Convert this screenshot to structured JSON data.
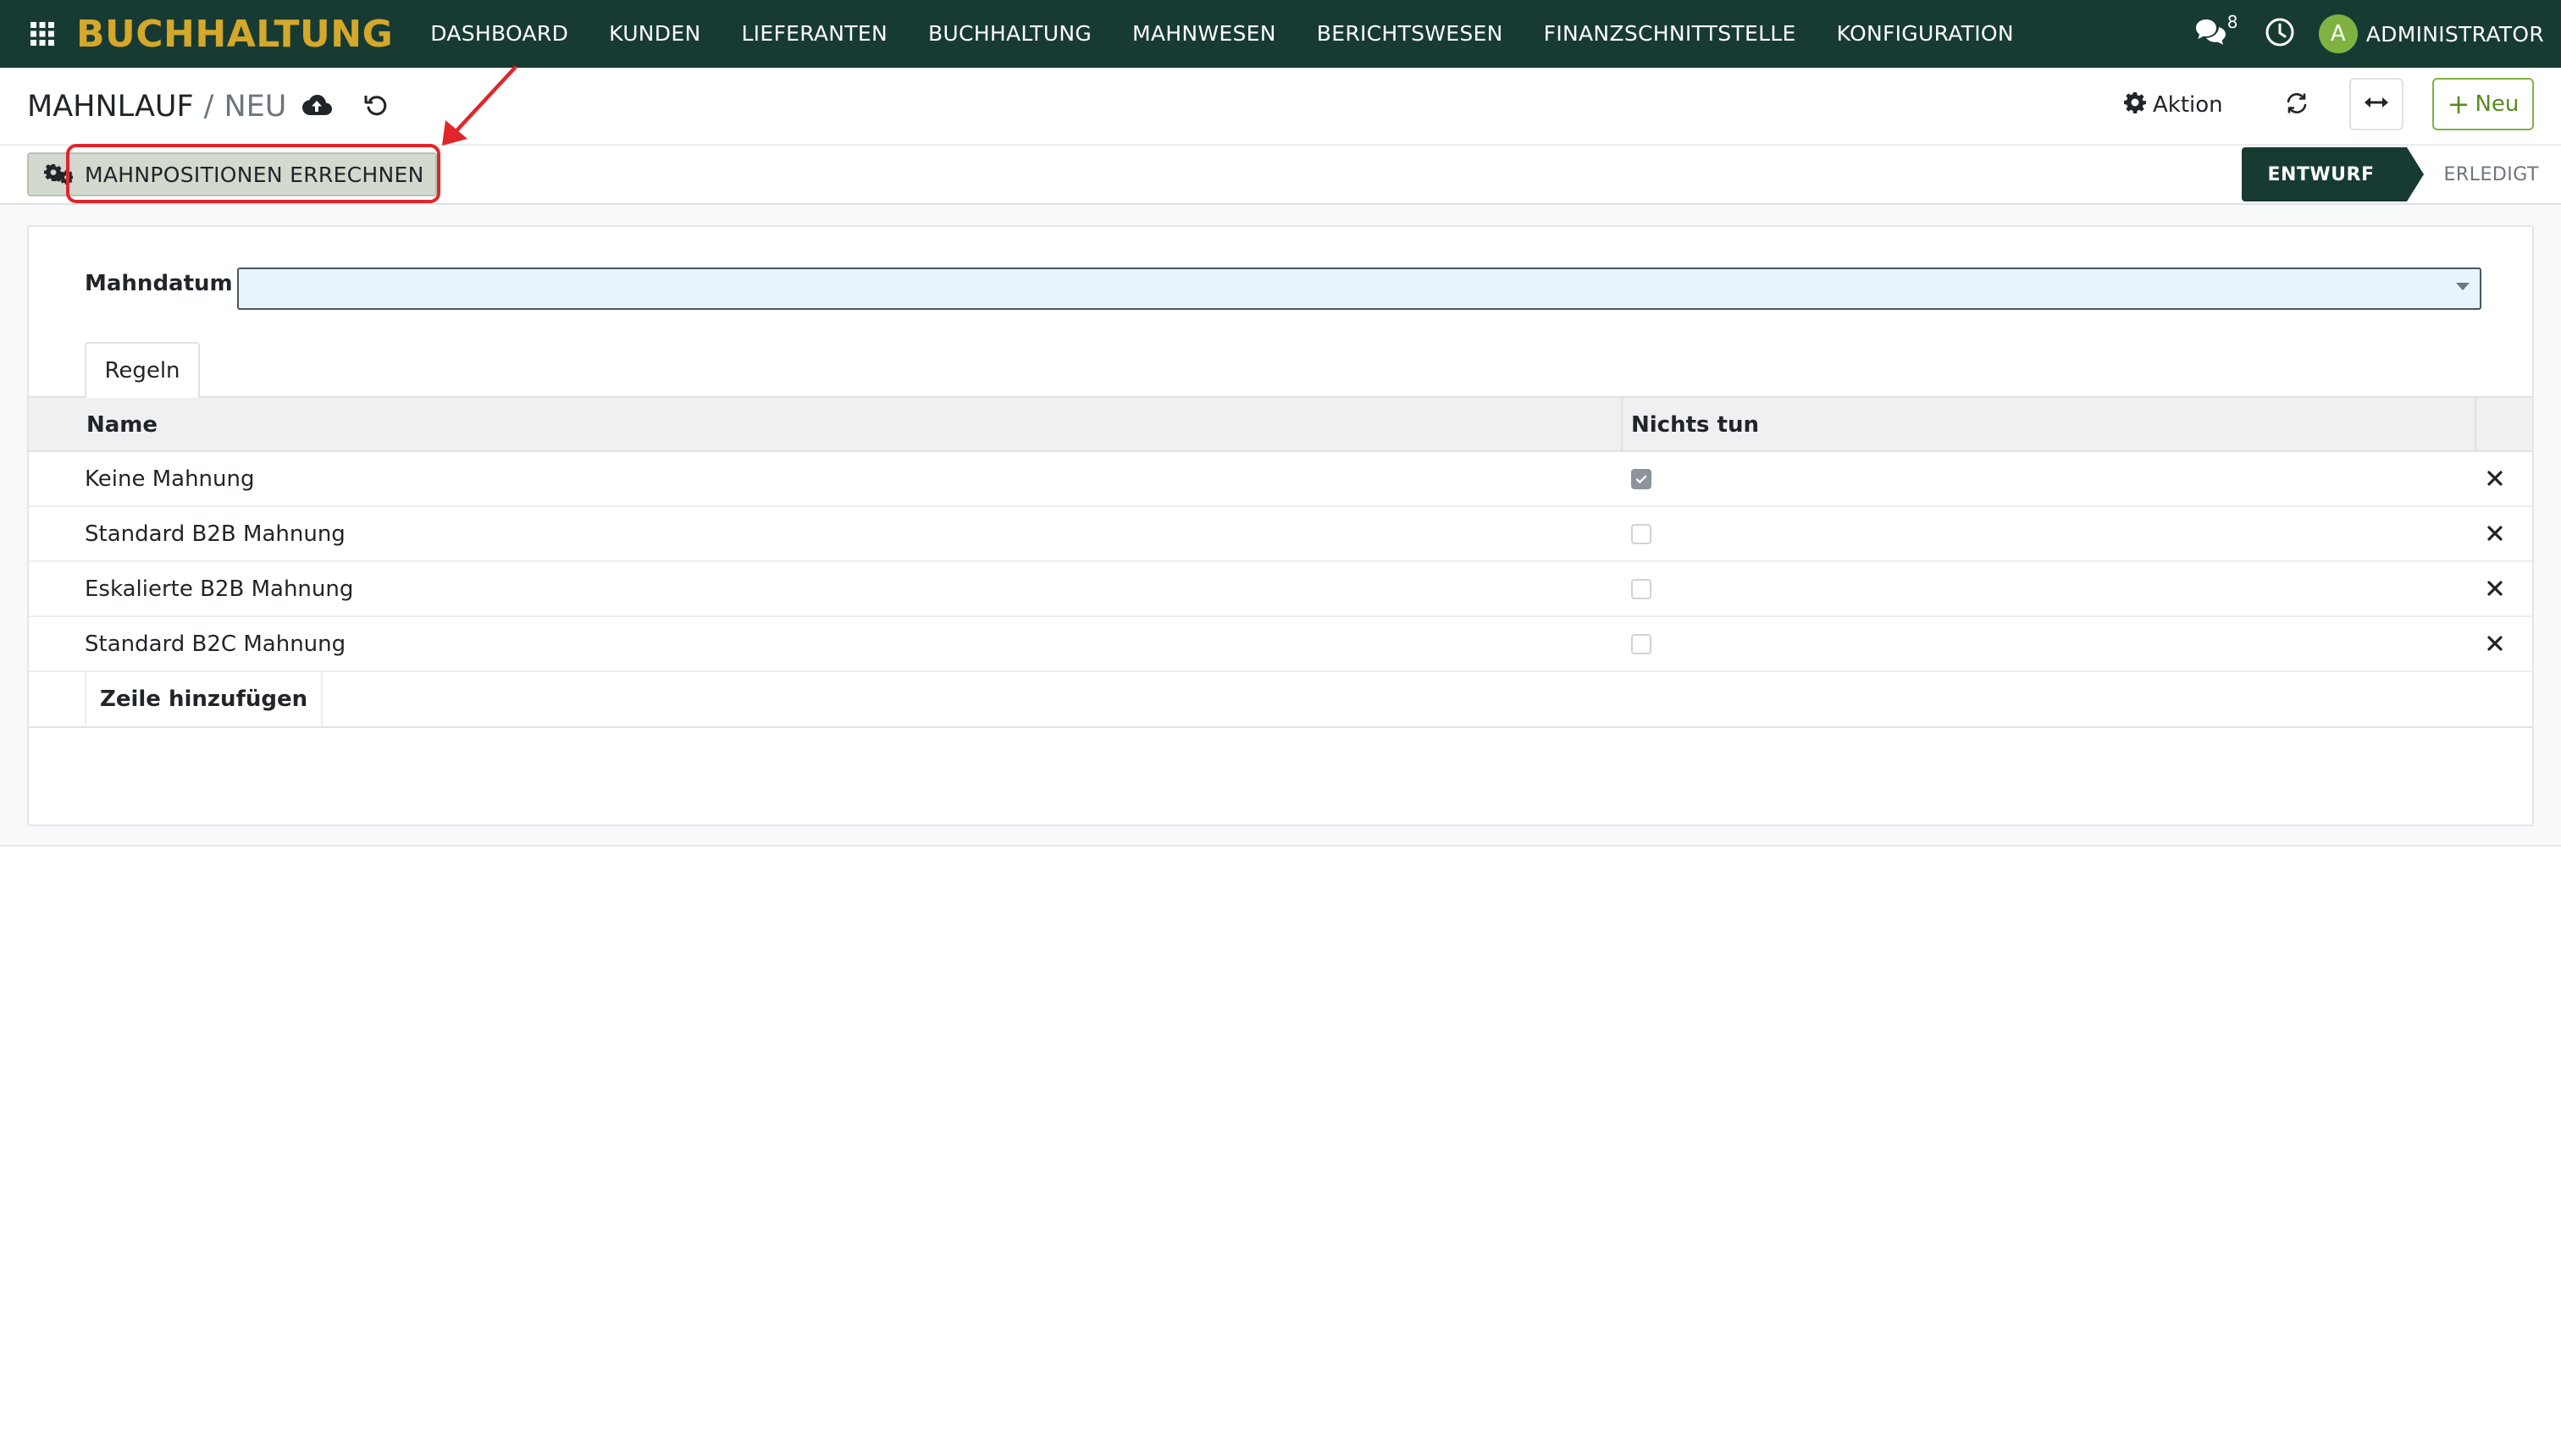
{
  "navbar": {
    "brand": "BUCHHALTUNG",
    "menu": [
      "DASHBOARD",
      "KUNDEN",
      "LIEFERANTEN",
      "BUCHHALTUNG",
      "MAHNWESEN",
      "BERICHTSWESEN",
      "FINANZSCHNITTSTELLE",
      "KONFIGURATION"
    ],
    "chat_count": "8",
    "avatar_letter": "A",
    "user": "ADMINISTRATOR"
  },
  "breadcrumb": {
    "main": "MAHNLAUF",
    "separator": "/",
    "current": "NEU"
  },
  "toolbar": {
    "action_label": "Aktion",
    "new_label": "Neu"
  },
  "header_button": {
    "compute_label": "MAHNPOSITIONEN ERRECHNEN"
  },
  "statusbar": {
    "active": "ENTWURF",
    "inactive": "ERLEDIGT"
  },
  "form": {
    "date_label": "Mahndatum",
    "date_value": "",
    "tab_label": "Regeln",
    "columns": {
      "name": "Name",
      "nothing": "Nichts tun"
    },
    "rows": [
      {
        "name": "Keine Mahnung",
        "nothing": true
      },
      {
        "name": "Standard B2B Mahnung",
        "nothing": false
      },
      {
        "name": "Eskalierte B2B Mahnung",
        "nothing": false
      },
      {
        "name": "Standard B2C Mahnung",
        "nothing": false
      }
    ],
    "add_line_label": "Zeile hinzufügen"
  },
  "colors": {
    "navbar_bg": "#173b33",
    "brand": "#d4a82a",
    "accent_green": "#7fb241",
    "highlight": "#e0262b"
  },
  "icons": [
    "apps-icon",
    "chat-icon",
    "clock-icon",
    "cloud-upload-icon",
    "undo-icon",
    "gear-icon",
    "refresh-icon",
    "expand-icon",
    "plus-icon",
    "gears-icon",
    "close-icon"
  ]
}
